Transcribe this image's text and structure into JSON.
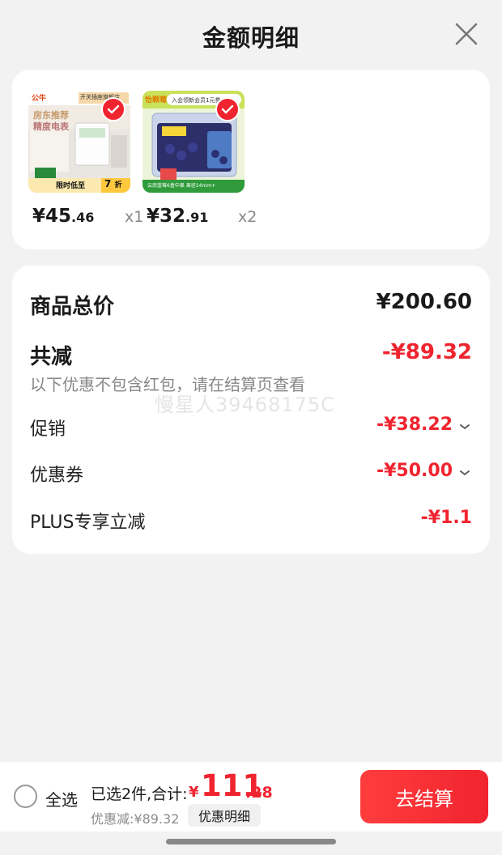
{
  "header": {
    "title": "金额明细"
  },
  "products": [
    {
      "price_yen": "¥",
      "price_int": "45",
      "price_dec": ".46",
      "qty": "x1",
      "thumb": {
        "brand": "公牛",
        "shop": "开关插座旗舰店",
        "headline1": "房东推荐",
        "headline2": "精度电表",
        "promo": "限时低至",
        "discount": "7",
        "discount_unit": "折"
      }
    },
    {
      "price_yen": "¥",
      "price_int": "32",
      "price_dec": ".91",
      "qty": "x2",
      "thumb": {
        "brand": "怡颗莓",
        "banner": "入会领新会员1元券",
        "footer": "云南蓝莓6盒中果 果径14mm+"
      }
    }
  ],
  "summary": {
    "total_label": "商品总价",
    "total_value": "¥200.60",
    "reduce_label": "共减",
    "reduce_value": "-¥89.32",
    "note": "以下优惠不包含红包，请在结算页查看",
    "watermark": "慢星人39468175C",
    "items": [
      {
        "label": "促销",
        "value": "-¥38.22",
        "expandable": true
      },
      {
        "label": "优惠券",
        "value": "-¥50.00",
        "expandable": true
      },
      {
        "label": "PLUS专享立减",
        "value": "-¥1.1",
        "expandable": false
      }
    ]
  },
  "bottom": {
    "select_all": "全选",
    "selected_text": "已选2件,合计:",
    "total_yen": "¥",
    "total_int": "111",
    "total_dec": ".28",
    "discount_text": "优惠减:¥89.32",
    "detail_button": "优惠明细",
    "checkout_button": "去结算"
  },
  "colors": {
    "accent": "#f0242f",
    "background": "#f2f2f2",
    "card": "#ffffff"
  }
}
